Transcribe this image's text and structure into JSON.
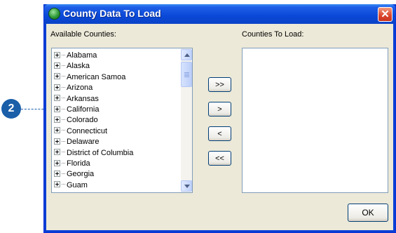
{
  "dialog": {
    "title": "County Data To Load",
    "close_glyph": "✕"
  },
  "left_panel": {
    "label": "Available Counties:",
    "items": [
      "Alabama",
      "Alaska",
      "American Samoa",
      "Arizona",
      "Arkansas",
      "California",
      "Colorado",
      "Connecticut",
      "Delaware",
      "District of Columbia",
      "Florida",
      "Georgia",
      "Guam"
    ]
  },
  "right_panel": {
    "label": "Counties To Load:"
  },
  "transfer_buttons": {
    "add_all": ">>",
    "add": ">",
    "remove": "<",
    "remove_all": "<<"
  },
  "ok_label": "OK",
  "callout": {
    "number": "2"
  },
  "colors": {
    "titlebar": "#0a48d8",
    "client": "#ece9d8",
    "callout": "#1a5fa8"
  },
  "icons": {
    "app": "globe-icon",
    "expand": "plus-box-icon",
    "close": "close-icon"
  }
}
